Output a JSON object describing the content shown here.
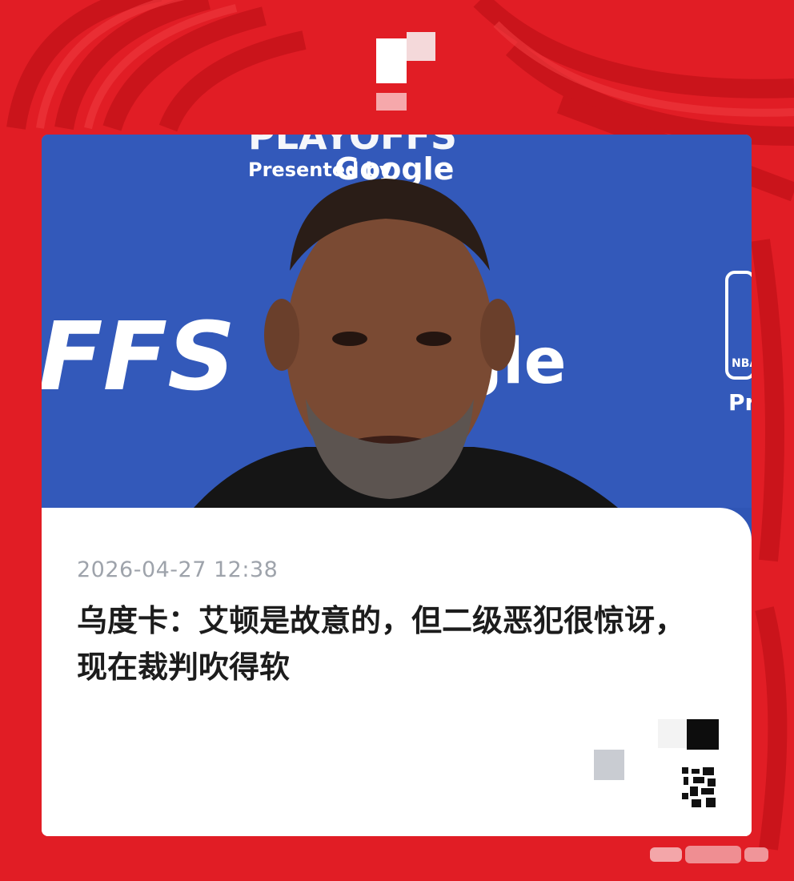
{
  "article": {
    "timestamp": "2026-04-27 12:38",
    "headline": "乌度卡：艾顿是故意的，但二级恶犯很惊讶，现在裁判吹得软"
  },
  "photo_backdrop": {
    "presented_by": "Presented by",
    "sponsor": "Google",
    "sponsor_fragment": "gle",
    "playoffs_fragment": "FFS",
    "nba_fragment": "NBA",
    "pre_fragment": "Pre"
  },
  "colors": {
    "background_red": "#e11d25",
    "backdrop_blue": "#2f55b5",
    "card_white": "#ffffff",
    "timestamp_gray": "#9ea3ab",
    "headline_black": "#1c1c1c"
  },
  "icons": {
    "top_logo": "brand-logo-icon",
    "qr_code": "qr-code-icon",
    "watermark": "watermark-icon"
  }
}
